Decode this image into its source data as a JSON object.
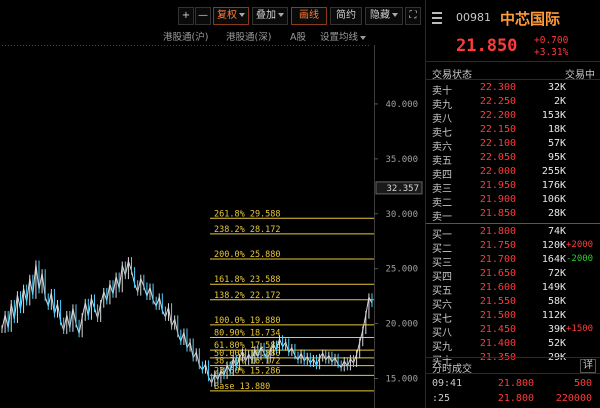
{
  "toolbar": {
    "plus": "+",
    "minus": "—",
    "adjust": "复权",
    "overlay": "叠加",
    "draw": "画线",
    "simple": "简约",
    "hide": "隐藏",
    "expand": "⛶"
  },
  "subbar": {
    "hk_sh": "港股通(沪)",
    "hk_sz": "港股通(深)",
    "a_share": "A股",
    "ma_settings": "设置均线"
  },
  "chart_data": {
    "type": "line",
    "price_axis": [
      {
        "value": 40,
        "label": "40.000"
      },
      {
        "value": 35,
        "label": "35.000"
      },
      {
        "value": 30,
        "label": "30.000"
      },
      {
        "value": 25,
        "label": "25.000"
      },
      {
        "value": 20,
        "label": "20.000"
      },
      {
        "value": 15,
        "label": "15.000"
      }
    ],
    "current_marker": {
      "value": 32.357,
      "label": "32.357"
    },
    "ylim": [
      13.5,
      44
    ],
    "fib_levels": [
      {
        "value": 29.588,
        "label": "261.8% 29.588"
      },
      {
        "value": 28.172,
        "label": "238.2% 28.172"
      },
      {
        "value": 25.88,
        "label": "200.0% 25.880"
      },
      {
        "value": 23.588,
        "label": "161.8% 23.588"
      },
      {
        "value": 22.172,
        "label": "138.2% 22.172"
      },
      {
        "value": 19.88,
        "label": "100.0% 19.880"
      },
      {
        "value": 18.734,
        "label": "80.90% 18.734"
      },
      {
        "value": 17.588,
        "label": "61.80% 17.588"
      },
      {
        "value": 16.88,
        "label": "50.00% 16.880"
      },
      {
        "value": 16.172,
        "label": "38.20% 16.172"
      },
      {
        "value": 15.286,
        "label": "23.60% 15.286"
      },
      {
        "value": 13.88,
        "label": "Base 13.880"
      }
    ],
    "series": [
      {
        "values": [
          19.5,
          20.8,
          19.6,
          21.8,
          20.4,
          22.6,
          21.3,
          23.2,
          22.0,
          24.1,
          22.6,
          25.4,
          23.1,
          24.6,
          22.4,
          21.6,
          22.8,
          20.9,
          21.8,
          20.2,
          19.4,
          20.8,
          19.6,
          21.4,
          20.0,
          19.1,
          20.6,
          21.9,
          20.7,
          22.3,
          21.4,
          20.5,
          21.8,
          22.9,
          22.1,
          23.6,
          22.7,
          24.3,
          23.2,
          25.3,
          24.4,
          25.7,
          24.8,
          23.6,
          22.9,
          24.1,
          23.4,
          22.5,
          23.3,
          22.1,
          21.6,
          22.4,
          21.2,
          20.6,
          21.5,
          19.8,
          20.4,
          19.1,
          18.4,
          19.2,
          17.8,
          18.3,
          16.9,
          17.4,
          16.2,
          15.8,
          16.3,
          15.1,
          14.6,
          15.4,
          14.9,
          15.7,
          15.3,
          16.2,
          15.6,
          16.8,
          16.1,
          16.9,
          17.4,
          16.6,
          17.2,
          16.7,
          17.6,
          17.0,
          17.9,
          17.3,
          16.8,
          17.5,
          18.1,
          17.6,
          18.6,
          17.9,
          18.3,
          17.4,
          17.8,
          17.1,
          16.7,
          17.3,
          16.6,
          17.0,
          16.4,
          16.8,
          16.2,
          16.9,
          17.3,
          16.7,
          17.1,
          16.5,
          16.9,
          16.3,
          16.0,
          16.6,
          16.1,
          16.8,
          16.4,
          17.2,
          18.3,
          19.4,
          20.8,
          22.4,
          21.85
        ]
      }
    ]
  },
  "quote": {
    "code": "00981",
    "name": "中芯国际",
    "price": "21.850",
    "change_abs": "+0.700",
    "change_pct": "+3.31%",
    "status_label": "交易状态",
    "status_value": "交易中"
  },
  "orderbook": [
    {
      "label": "卖十",
      "price": "22.300",
      "vol": "32K",
      "delta": ""
    },
    {
      "label": "卖九",
      "price": "22.250",
      "vol": "2K",
      "delta": ""
    },
    {
      "label": "卖八",
      "price": "22.200",
      "vol": "153K",
      "delta": ""
    },
    {
      "label": "卖七",
      "price": "22.150",
      "vol": "18K",
      "delta": ""
    },
    {
      "label": "卖六",
      "price": "22.100",
      "vol": "57K",
      "delta": ""
    },
    {
      "label": "卖五",
      "price": "22.050",
      "vol": "95K",
      "delta": ""
    },
    {
      "label": "卖四",
      "price": "22.000",
      "vol": "255K",
      "delta": ""
    },
    {
      "label": "卖三",
      "price": "21.950",
      "vol": "176K",
      "delta": ""
    },
    {
      "label": "卖二",
      "price": "21.900",
      "vol": "106K",
      "delta": ""
    },
    {
      "label": "卖一",
      "price": "21.850",
      "vol": "28K",
      "delta": ""
    },
    {
      "label": "买一",
      "price": "21.800",
      "vol": "74K",
      "delta": ""
    },
    {
      "label": "买二",
      "price": "21.750",
      "vol": "120K",
      "delta": "+2000"
    },
    {
      "label": "买三",
      "price": "21.700",
      "vol": "164K",
      "delta": "-2000"
    },
    {
      "label": "买四",
      "price": "21.650",
      "vol": "72K",
      "delta": ""
    },
    {
      "label": "买五",
      "price": "21.600",
      "vol": "149K",
      "delta": ""
    },
    {
      "label": "买六",
      "price": "21.550",
      "vol": "58K",
      "delta": ""
    },
    {
      "label": "买七",
      "price": "21.500",
      "vol": "112K",
      "delta": ""
    },
    {
      "label": "买八",
      "price": "21.450",
      "vol": "39K",
      "delta": "+1500"
    },
    {
      "label": "买九",
      "price": "21.400",
      "vol": "52K",
      "delta": ""
    },
    {
      "label": "买十",
      "price": "21.350",
      "vol": "29K",
      "delta": ""
    }
  ],
  "trades": {
    "title": "分时成交",
    "detail": "详",
    "rows": [
      {
        "time": "09:41",
        "price": "21.800",
        "vol": "500"
      },
      {
        "time": ":25",
        "price": "21.800",
        "vol": "220000"
      }
    ]
  },
  "colors": {
    "up": "#ff3a3a",
    "down": "#2ad02a",
    "fib": "#e8c83a",
    "line": "#d8d8d8"
  }
}
